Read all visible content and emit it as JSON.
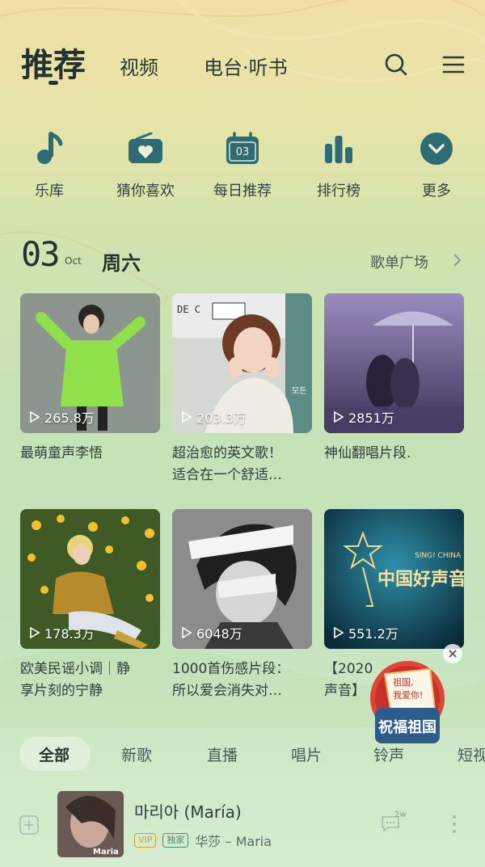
{
  "top_nav": {
    "tabs": [
      "推荐",
      "视频",
      "电台·听书"
    ]
  },
  "quick_links": [
    {
      "label": "乐库",
      "icon": "music-note-icon"
    },
    {
      "label": "猜你喜欢",
      "icon": "radio-heart-icon"
    },
    {
      "label": "每日推荐",
      "icon": "calendar-icon",
      "badge": "03"
    },
    {
      "label": "排行榜",
      "icon": "bar-chart-icon"
    },
    {
      "label": "更多",
      "icon": "chevron-down-icon"
    }
  ],
  "date": {
    "day": "03",
    "month": "Oct",
    "weekday": "周六"
  },
  "playlist_plaza": "歌单广场",
  "cards": [
    {
      "plays": "265.8万",
      "title_lines": [
        "最萌童声李悟",
        ""
      ]
    },
    {
      "plays": "203.3万",
      "title_lines": [
        "超治愈的英文歌！",
        "适合在一个舒适…"
      ]
    },
    {
      "plays": "2851万",
      "title_lines": [
        "神仙翻唱片段.",
        ""
      ]
    },
    {
      "plays": "178.3万",
      "title_lines": [
        "欧美民谣小调｜静",
        "享片刻的宁静"
      ]
    },
    {
      "plays": "6048万",
      "title_lines": [
        "1000首伤感片段：",
        "所以爱会消失对…"
      ]
    },
    {
      "plays": "551.2万",
      "title_lines": [
        "【2020",
        "声音】"
      ]
    }
  ],
  "card_art_text": {
    "card6_logo_cn": "中国好声音",
    "card6_logo_en": "SING! CHINA",
    "card2_sign": "모든",
    "card2_label": "DE C"
  },
  "float_badge": {
    "line1": "祖国,",
    "line2": "我爱你!",
    "big": "祝福祖国"
  },
  "categories": [
    "全部",
    "新歌",
    "直播",
    "唱片",
    "铃声",
    "短视"
  ],
  "song": {
    "title": "마리아 (María)",
    "tag_vip": "VIP",
    "tag_exclusive": "独家",
    "artist": "华莎 – Maria",
    "thumb_text": "Maria",
    "comment_count": "2w"
  },
  "colors": {
    "accent": "#2e6b75",
    "text": "#2f3e3a"
  }
}
